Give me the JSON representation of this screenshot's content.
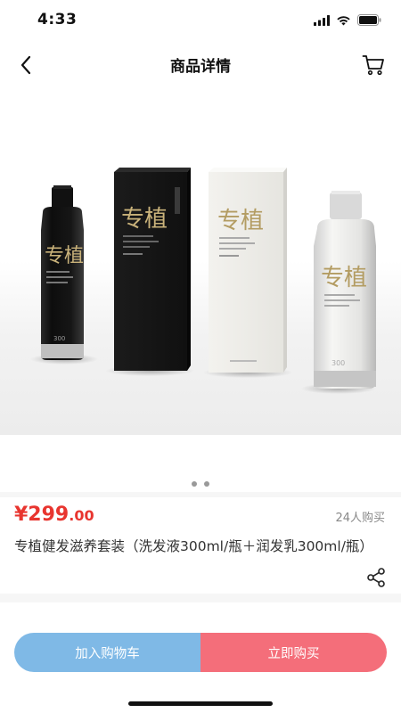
{
  "status": {
    "time": "4:33"
  },
  "nav": {
    "title": "商品详情"
  },
  "gallery": {
    "brand_chars": "专植",
    "volume_badge": "300",
    "page_count": 2,
    "current_page": 1
  },
  "product": {
    "price_main": "¥299",
    "price_decimal": ".00",
    "buyers": "24人购买",
    "title": "专植健发滋养套装（洗发液300ml/瓶＋润发乳300ml/瓶）"
  },
  "actions": {
    "add_to_cart": "加入购物车",
    "buy_now": "立即购买"
  },
  "colors": {
    "price": "#e8352f",
    "cart_button": "#7fb9e6",
    "buy_button": "#f46e7a"
  },
  "icons": {
    "back": "chevron-left-icon",
    "cart": "cart-icon",
    "share": "share-icon"
  }
}
